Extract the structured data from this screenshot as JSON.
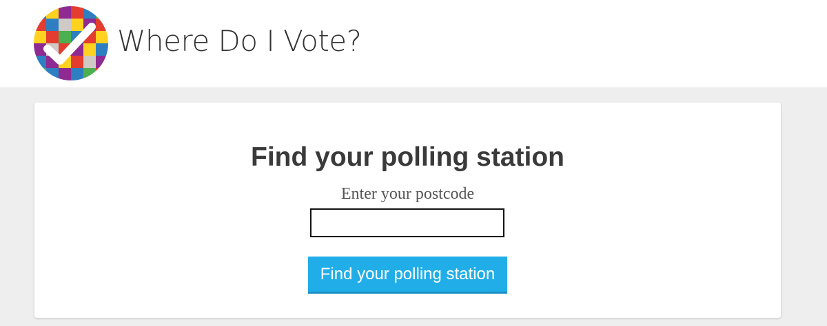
{
  "header": {
    "site_title": "Where Do I Vote?",
    "logo_icon": "checkered-ballot-check-icon"
  },
  "search": {
    "heading": "Find your polling station",
    "postcode_label": "Enter your postcode",
    "postcode_value": "",
    "submit_label": "Find your polling station"
  },
  "colors": {
    "page_background": "#eeeeee",
    "header_background": "#ffffff",
    "button_background": "#21aee8",
    "button_text": "#ffffff",
    "heading_text": "#3a3a3a"
  }
}
